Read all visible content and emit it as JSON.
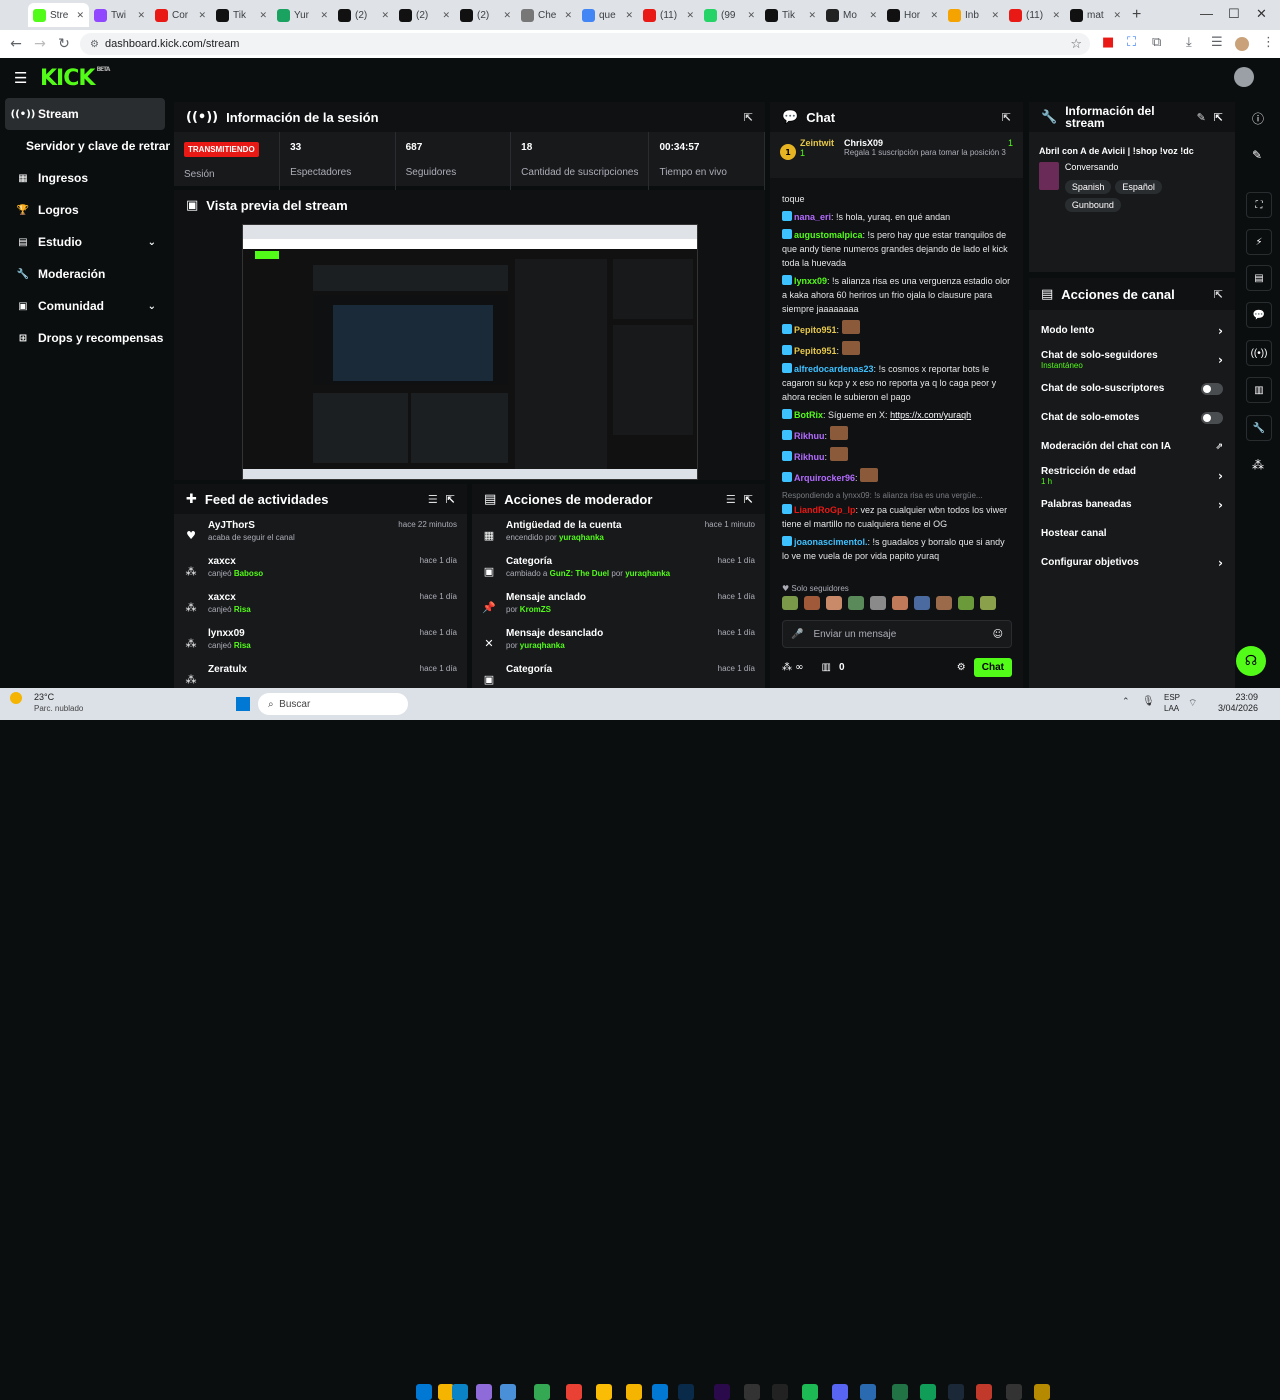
{
  "browser": {
    "tabs": [
      {
        "label": "Stre",
        "color": "#53fc18",
        "active": true
      },
      {
        "label": "Twi",
        "color": "#9146ff"
      },
      {
        "label": "Cor",
        "color": "#e91916"
      },
      {
        "label": "Tik",
        "color": "#111"
      },
      {
        "label": "Yur",
        "color": "#1aa260"
      },
      {
        "label": "(2)",
        "color": "#111"
      },
      {
        "label": "(2)",
        "color": "#111"
      },
      {
        "label": "(2)",
        "color": "#111"
      },
      {
        "label": "Che",
        "color": "#777"
      },
      {
        "label": "que",
        "color": "#4285f4"
      },
      {
        "label": "(11)",
        "color": "#e91916"
      },
      {
        "label": "(99",
        "color": "#25d366"
      },
      {
        "label": "Tik",
        "color": "#111"
      },
      {
        "label": "Mo",
        "color": "#222"
      },
      {
        "label": "Hor",
        "color": "#111"
      },
      {
        "label": "Inb",
        "color": "#f4a300"
      },
      {
        "label": "(11)",
        "color": "#e91916"
      },
      {
        "label": "mat",
        "color": "#111"
      }
    ],
    "url": "dashboard.kick.com/stream"
  },
  "header": {
    "logo": "KICK",
    "beta": "BETA"
  },
  "sidebar": {
    "items": [
      {
        "label": "Stream",
        "icon": "signal-icon",
        "glyph": "((•))"
      },
      {
        "label": "Servidor y clave de retransmisión",
        "icon": "",
        "glyph": ""
      },
      {
        "label": "Ingresos",
        "icon": "chart-icon",
        "glyph": "▦"
      },
      {
        "label": "Logros",
        "icon": "trophy-icon",
        "glyph": "🏆"
      },
      {
        "label": "Estudio",
        "icon": "layout-icon",
        "glyph": "▤"
      },
      {
        "label": "Moderación",
        "icon": "wrench-icon",
        "glyph": "🔧"
      },
      {
        "label": "Comunidad",
        "icon": "community-icon",
        "glyph": "▣"
      },
      {
        "label": "Drops y recompensas",
        "icon": "drops-icon",
        "glyph": "⊞"
      }
    ]
  },
  "session": {
    "title": "Información de la sesión",
    "live": "TRANSMITIENDO",
    "live_label": "Sesión",
    "stats": [
      {
        "value": "33",
        "label": "Espectadores"
      },
      {
        "value": "687",
        "label": "Seguidores"
      },
      {
        "value": "18",
        "label": "Cantidad de suscripciones"
      },
      {
        "value": "00:34:57",
        "label": "Tiempo en vivo"
      }
    ]
  },
  "preview": {
    "title": "Vista previa del stream"
  },
  "activity": {
    "title": "Feed de actividades",
    "items": [
      {
        "user": "AyJThorS",
        "text": "acaba de seguir el canal",
        "hl": "",
        "time": "hace 22 minutos",
        "icon": "heart-icon",
        "glyph": "♥"
      },
      {
        "user": "xaxcx",
        "text": "canjeó",
        "hl": "Baboso",
        "time": "hace 1 día",
        "icon": "drops-icon",
        "glyph": "⁂"
      },
      {
        "user": "xaxcx",
        "text": "canjeó",
        "hl": "Risa",
        "time": "hace 1 día",
        "icon": "drops-icon",
        "glyph": "⁂"
      },
      {
        "user": "lynxx09",
        "text": "canjeó",
        "hl": "Risa",
        "time": "hace 1 día",
        "icon": "drops-icon",
        "glyph": "⁂"
      },
      {
        "user": "Zeratulx",
        "text": "",
        "hl": "",
        "time": "hace 1 día",
        "icon": "drops-icon",
        "glyph": "⁂"
      }
    ]
  },
  "modactions": {
    "title": "Acciones de moderador",
    "items": [
      {
        "title": "Antigüedad de la cuenta",
        "text": "encendido por",
        "hl": "yuraqhanka",
        "time": "hace 1 minuto",
        "glyph": "▦"
      },
      {
        "title": "Categoría",
        "text": "cambiado a",
        "hl": "GunZ: The Duel",
        "text2": "por",
        "hl2": "yuraqhanka",
        "time": "hace 1 día",
        "glyph": "▣"
      },
      {
        "title": "Mensaje anclado",
        "text": "por",
        "hl": "KromZS",
        "time": "hace 1 día",
        "glyph": "📌"
      },
      {
        "title": "Mensaje desanclado",
        "text": "por",
        "hl": "yuraqhanka",
        "time": "hace 1 día",
        "glyph": "✕"
      },
      {
        "title": "Categoría",
        "text": "",
        "hl": "",
        "time": "hace 1 día",
        "glyph": "▣"
      }
    ]
  },
  "chat": {
    "title": "Chat",
    "top1": {
      "name": "Zeintwit",
      "count": "1"
    },
    "top2": {
      "name": "ChrisX09",
      "count": "1",
      "text": "Regala 1 suscripción para tomar la posición 3"
    },
    "messages": [
      {
        "user": "",
        "color": "#e6e6e6",
        "text": "toque"
      },
      {
        "user": "nana_eri",
        "color": "#b36bff",
        "text": "!s hola, yuraq. en qué andan"
      },
      {
        "user": "augustomalpica",
        "color": "#53fc18",
        "text": "!s pero hay que estar tranquilos de que andy tiene numeros grandes dejando de lado el kick toda la huevada"
      },
      {
        "user": "lynxx09",
        "color": "#53fc18",
        "text": "!s alianza risa es una verguenza estadio olor a kaka ahora 60 heriros un frio ojala lo clausure para siempre jaaaaaaaa"
      },
      {
        "user": "Pepito951",
        "color": "#e6c84a",
        "text": ""
      },
      {
        "user": "Pepito951",
        "color": "#e6c84a",
        "text": ""
      },
      {
        "user": "alfredocardenas23",
        "color": "#3ec1ff",
        "text": "!s cosmos x reportar bots le cagaron su kcp y x eso no reporta ya q lo caga peor y ahora recien le subieron el pago"
      },
      {
        "user": "BotRix",
        "color": "#53fc18",
        "text": "Sígueme en X:",
        "link": "https://x.com/yuraqh"
      },
      {
        "user": "Rikhuu",
        "color": "#b36bff",
        "text": ""
      },
      {
        "user": "Rikhuu",
        "color": "#b36bff",
        "text": ""
      },
      {
        "user": "Arquirocker96",
        "color": "#b36bff",
        "text": ""
      },
      {
        "user": "LiandRoGp_lp",
        "color": "#e91916",
        "text": "vez pa cualquier wbn todos los viwer tiene el martillo no cualquiera tiene el OG",
        "reply": "Respondiendo a lynxx09: !s alianza risa es una vergüe..."
      },
      {
        "user": "joaonascimentol.",
        "color": "#3ec1ff",
        "text": "!s guadalos y borralo que si andy lo ve me vuela de por vida papito yuraq"
      }
    ],
    "followers_only": "Solo seguidores",
    "input_placeholder": "Enviar un mensaje",
    "count": "0",
    "send_label": "Chat"
  },
  "streaminfo": {
    "title": "Información del stream",
    "stream_title": "Abril con A de Avicii | !shop !voz !dc",
    "category": "Conversando",
    "tags": [
      "Spanish",
      "Español",
      "Gunbound"
    ]
  },
  "channel": {
    "title": "Acciones de canal",
    "rows": [
      {
        "label": "Modo lento",
        "sub": "",
        "ctrl": "chevron"
      },
      {
        "label": "Chat de solo-seguidores",
        "sub": "Instantáneo",
        "ctrl": "chevron"
      },
      {
        "label": "Chat de solo-suscriptores",
        "sub": "",
        "ctrl": "toggle"
      },
      {
        "label": "Chat de solo-emotes",
        "sub": "",
        "ctrl": "toggle"
      },
      {
        "label": "Moderación del chat con IA",
        "sub": "",
        "ctrl": "external"
      },
      {
        "label": "Restricción de edad",
        "sub": "1 h",
        "ctrl": "chevron"
      },
      {
        "label": "Palabras baneadas",
        "sub": "",
        "ctrl": "chevron"
      },
      {
        "label": "Hostear canal",
        "sub": "",
        "ctrl": "none"
      },
      {
        "label": "Configurar objetivos",
        "sub": "",
        "ctrl": "chevron"
      }
    ]
  },
  "taskbar": {
    "weather_temp": "23°C",
    "weather_desc": "Parc. nublado",
    "search": "Buscar",
    "lang1": "ESP",
    "lang2": "LAA",
    "time": "23:09",
    "date": "3/04/2026"
  }
}
